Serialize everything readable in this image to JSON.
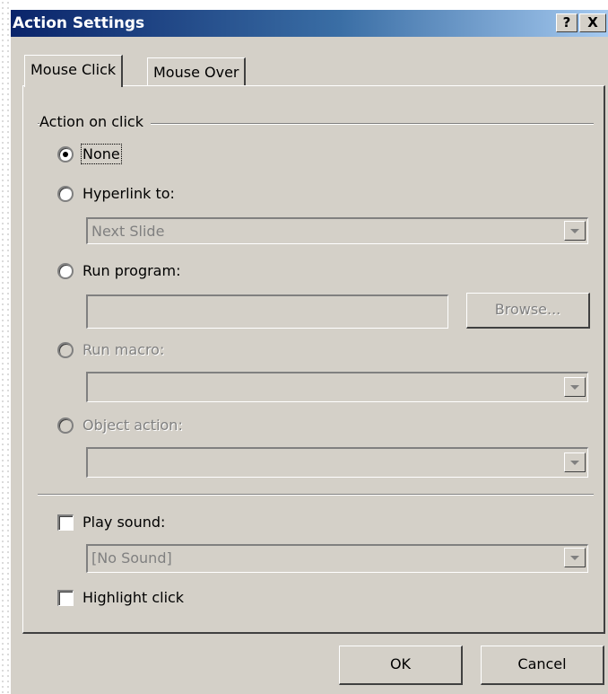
{
  "window": {
    "title": "Action Settings",
    "help_glyph": "?",
    "close_glyph": "X"
  },
  "tabs": [
    {
      "label": "Mouse Click",
      "active": true
    },
    {
      "label": "Mouse Over",
      "active": false
    }
  ],
  "action_group": {
    "label": "Action on click",
    "options": [
      {
        "label": "None",
        "selected": true,
        "enabled": true
      },
      {
        "label": "Hyperlink to:",
        "selected": false,
        "enabled": true
      },
      {
        "label": "Run program:",
        "selected": false,
        "enabled": true
      },
      {
        "label": "Run macro:",
        "selected": false,
        "enabled": false
      },
      {
        "label": "Object action:",
        "selected": false,
        "enabled": false
      }
    ],
    "hyperlink_value": "Next Slide",
    "run_program_value": "",
    "browse_label": "Browse...",
    "macro_value": "",
    "object_action_value": ""
  },
  "sound": {
    "play_sound_label": "Play sound:",
    "play_sound_checked": false,
    "sound_value": "[No Sound]",
    "highlight_label": "Highlight click",
    "highlight_checked": false
  },
  "footer": {
    "ok_label": "OK",
    "cancel_label": "Cancel"
  },
  "colors": {
    "dialog_bg": "#d4d0c8",
    "titlebar_start": "#0a246a",
    "titlebar_end": "#a6caf0",
    "disabled_text": "#808080"
  }
}
